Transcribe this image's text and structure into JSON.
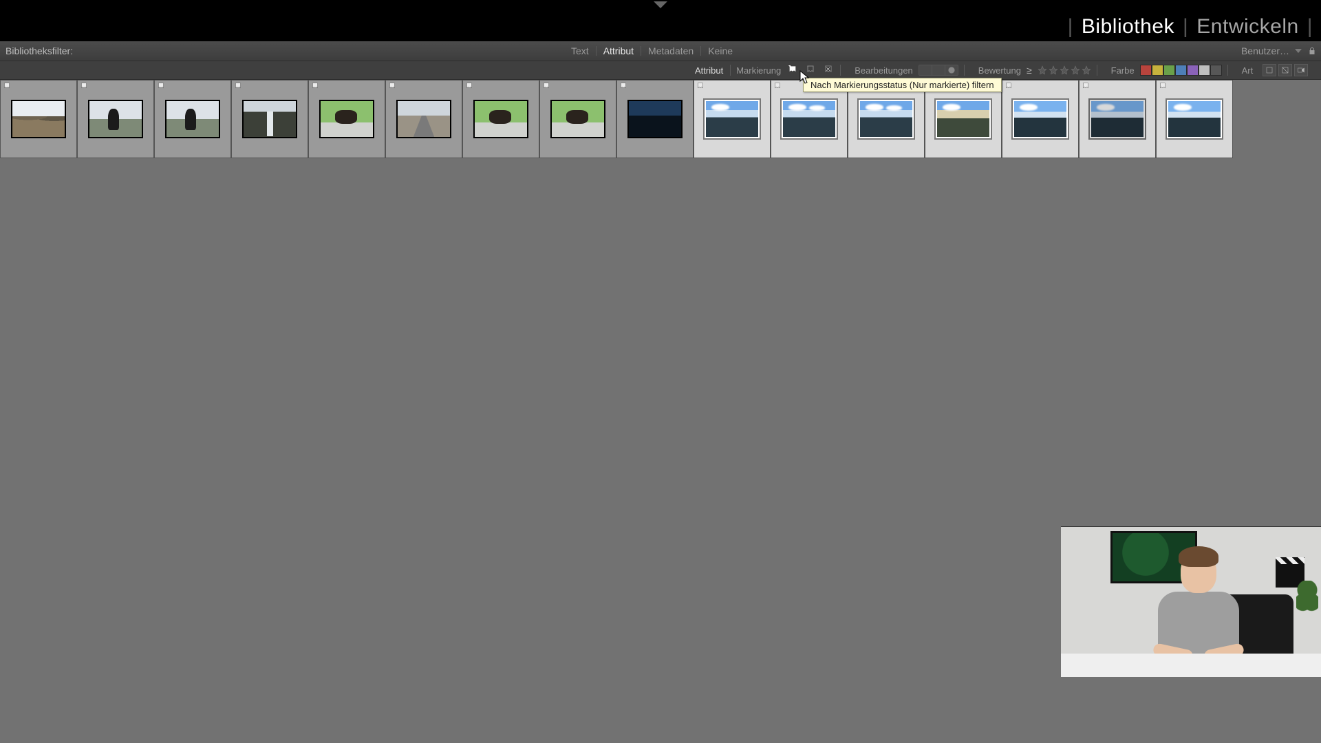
{
  "modules": {
    "library": "Bibliothek",
    "develop": "Entwickeln",
    "active": "library"
  },
  "filter_bar": {
    "label": "Bibliotheksfilter:",
    "tabs": {
      "text": "Text",
      "attribute": "Attribut",
      "metadata": "Metadaten",
      "none": "Keine",
      "active": "attribute"
    },
    "preset_label": "Benutzer…"
  },
  "attr_bar": {
    "attribute_label": "Attribut",
    "flag_label": "Markierung",
    "edits_label": "Bearbeitungen",
    "rating_label": "Bewertung",
    "color_label": "Farbe",
    "kind_label": "Art",
    "rating_operator": "≥",
    "tooltip": "Nach Markierungsstatus (Nur markierte) filtern"
  },
  "colors": {
    "red": "#b9443d",
    "yellow": "#c7b23d",
    "green": "#6aa04a",
    "blue": "#4e7fb8",
    "purple": "#8a62b8"
  },
  "thumbnails": [
    {
      "scene": "sc-landscape",
      "selected": false
    },
    {
      "scene": "sc-photographer",
      "selected": false
    },
    {
      "scene": "sc-photographer",
      "selected": false
    },
    {
      "scene": "sc-waterfall",
      "selected": false
    },
    {
      "scene": "sc-cow",
      "selected": false
    },
    {
      "scene": "sc-road",
      "selected": false
    },
    {
      "scene": "sc-cow",
      "selected": false
    },
    {
      "scene": "sc-cow",
      "selected": false
    },
    {
      "scene": "sc-darksea",
      "selected": false
    },
    {
      "scene": "sc-sky",
      "selected": true
    },
    {
      "scene": "sc-sky var2",
      "selected": true
    },
    {
      "scene": "sc-sky var2",
      "selected": true
    },
    {
      "scene": "sc-sky warm",
      "selected": true
    },
    {
      "scene": "sc-sky lake",
      "selected": true
    },
    {
      "scene": "sc-sky lake dim",
      "selected": true
    },
    {
      "scene": "sc-sky lake",
      "selected": true
    }
  ]
}
